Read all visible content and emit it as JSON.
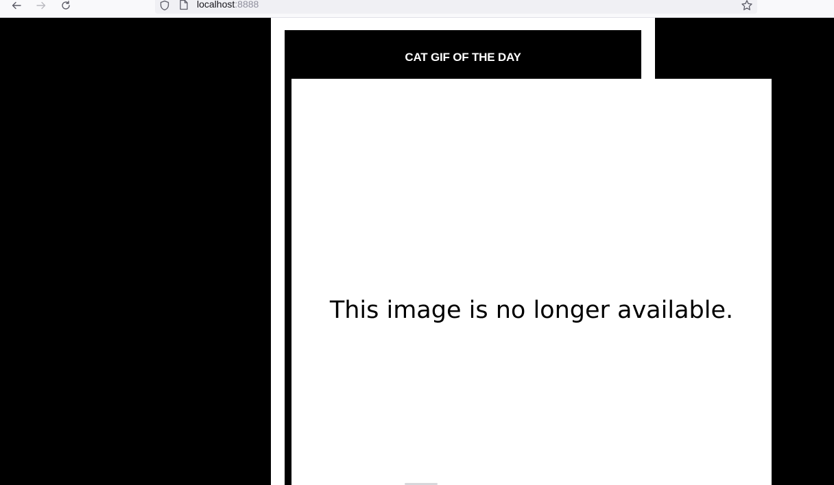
{
  "browser": {
    "back_icon": "arrow-left-icon",
    "forward_icon": "arrow-right-icon",
    "reload_icon": "reload-icon",
    "url_host": "localhost",
    "url_port": ":8888",
    "bookmark_icon": "star-icon"
  },
  "page": {
    "title": "CAT GIF OF THE DAY",
    "image_message": "This image is no longer available."
  },
  "colors": {
    "background": "#000000",
    "frame": "#ffffff",
    "title_text": "#ffffff"
  }
}
